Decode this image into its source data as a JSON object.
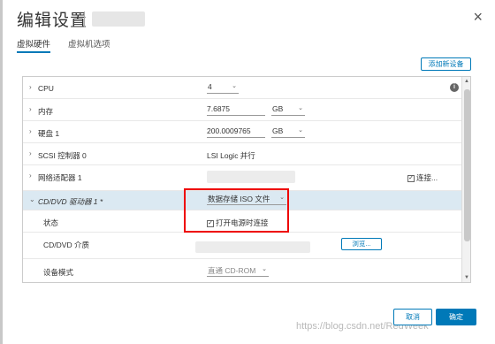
{
  "dialog": {
    "title": "编辑设置",
    "close_glyph": "×"
  },
  "tabs": [
    {
      "label": "虚拟硬件"
    },
    {
      "label": "虚拟机选项"
    }
  ],
  "toolbar": {
    "add_device_label": "添加新设备"
  },
  "rows": {
    "cpu": {
      "label": "CPU",
      "value": "4"
    },
    "memory": {
      "label": "内存",
      "value": "7.6875",
      "unit": "GB"
    },
    "disk1": {
      "label": "硬盘 1",
      "value": "200.0009765",
      "unit": "GB"
    },
    "scsi": {
      "label": "SCSI 控制器 0",
      "value": "LSI Logic 并行"
    },
    "network": {
      "label": "网络适配器 1",
      "connect_label": "连接..."
    },
    "cdrom": {
      "label": "CD/DVD 驱动器 1 *",
      "value": "数据存储 ISO 文件"
    },
    "status": {
      "label": "状态",
      "checkbox_label": "打开电源时连接"
    },
    "cd_media": {
      "label": "CD/DVD 介质",
      "browse_label": "浏览..."
    },
    "device_mode": {
      "label": "设备模式",
      "value": "直通 CD-ROM"
    }
  },
  "footer": {
    "cancel_label": "取消",
    "ok_label": "确定",
    "watermark": "https://blog.csdn.net/RedWeek"
  },
  "icons": {
    "chevron_right": "›",
    "chevron_down": "⌄",
    "info": "i",
    "check": "✓"
  },
  "colors": {
    "accent": "#0079b8",
    "highlight_row": "#dbe9f2",
    "annotation": "#e00000"
  }
}
